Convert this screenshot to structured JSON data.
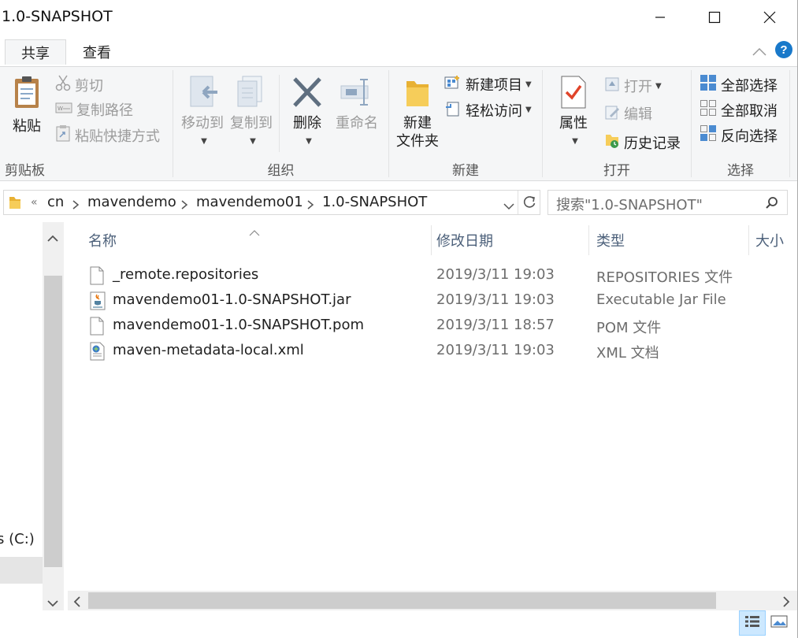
{
  "window": {
    "title": "1.0-SNAPSHOT",
    "minimize_icon": "minimize-icon",
    "maximize_icon": "maximize-icon",
    "close_icon": "close-icon"
  },
  "tabs": [
    {
      "label": "共享",
      "active": true
    },
    {
      "label": "查看",
      "active": false
    }
  ],
  "ribbon": {
    "clipboard": {
      "label": "剪贴板",
      "paste": "粘贴",
      "cut": "剪切",
      "copy_path": "复制路径",
      "paste_shortcut": "粘贴快捷方式"
    },
    "organize": {
      "label": "组织",
      "move_to": "移动到",
      "copy_to": "复制到",
      "delete": "删除",
      "rename": "重命名"
    },
    "new": {
      "label": "新建",
      "new_folder_line1": "新建",
      "new_folder_line2": "文件夹",
      "new_item": "新建项目",
      "easy_access": "轻松访问"
    },
    "open": {
      "label": "打开",
      "properties": "属性",
      "open": "打开",
      "edit": "编辑",
      "history": "历史记录"
    },
    "select": {
      "label": "选择",
      "select_all": "全部选择",
      "select_none": "全部取消",
      "invert": "反向选择"
    }
  },
  "address": {
    "overflow": "«",
    "crumbs": [
      "cn",
      "mavendemo",
      "mavendemo01",
      "1.0-SNAPSHOT"
    ],
    "search_placeholder": "搜索\"1.0-SNAPSHOT\""
  },
  "navpane": {
    "drive_label": "s (C:)"
  },
  "columns": {
    "name": "名称",
    "date": "修改日期",
    "type": "类型",
    "size": "大小"
  },
  "files": [
    {
      "name": "_remote.repositories",
      "date": "2019/3/11 19:03",
      "type": "REPOSITORIES 文件",
      "icon": "blank-file-icon"
    },
    {
      "name": "mavendemo01-1.0-SNAPSHOT.jar",
      "date": "2019/3/11 19:03",
      "type": "Executable Jar File",
      "icon": "java-jar-icon"
    },
    {
      "name": "mavendemo01-1.0-SNAPSHOT.pom",
      "date": "2019/3/11 18:57",
      "type": "POM 文件",
      "icon": "blank-file-icon"
    },
    {
      "name": "maven-metadata-local.xml",
      "date": "2019/3/11 19:03",
      "type": "XML 文档",
      "icon": "xml-file-icon"
    }
  ],
  "colors": {
    "accent": "#1979ca",
    "folder": "#f4c24d",
    "selection": "#cce8ff"
  }
}
